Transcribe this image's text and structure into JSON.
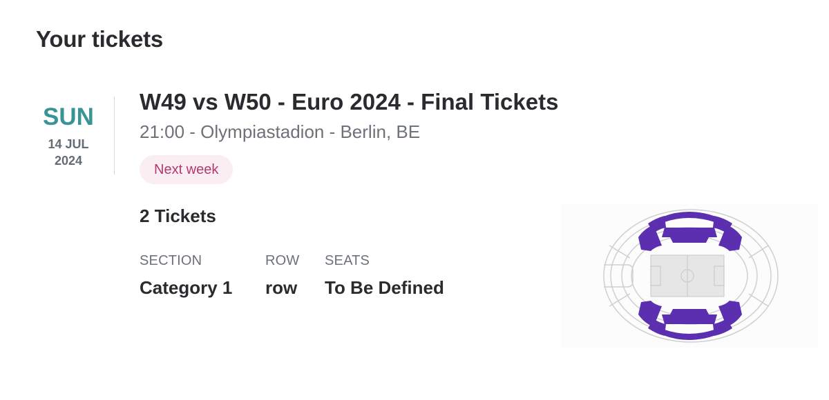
{
  "header": {
    "title": "Your tickets"
  },
  "event": {
    "date": {
      "day_name": "SUN",
      "day_month": "14 JUL",
      "year": "2024"
    },
    "title": "W49 vs W50 - Euro 2024 - Final Tickets",
    "subtitle": "21:00 - Olympiastadion - Berlin, BE",
    "badge": "Next week",
    "ticket_count": "2 Tickets",
    "details": {
      "section_label": "SECTION",
      "section_value": "Category 1",
      "row_label": "ROW",
      "row_value": "row",
      "seats_label": "SEATS",
      "seats_value": "To Be Defined"
    },
    "seating_map": {
      "icon": "stadium-seating-map",
      "highlight_color": "#5b2fb0",
      "pitch_color": "#e6e6e6",
      "outline_color": "#cfcfd3"
    }
  },
  "colors": {
    "day_accent": "#3a9394",
    "badge_bg": "#fbeef3",
    "badge_text": "#b23a6b",
    "text_primary": "#2b2b2f",
    "text_secondary": "#6d7178"
  }
}
